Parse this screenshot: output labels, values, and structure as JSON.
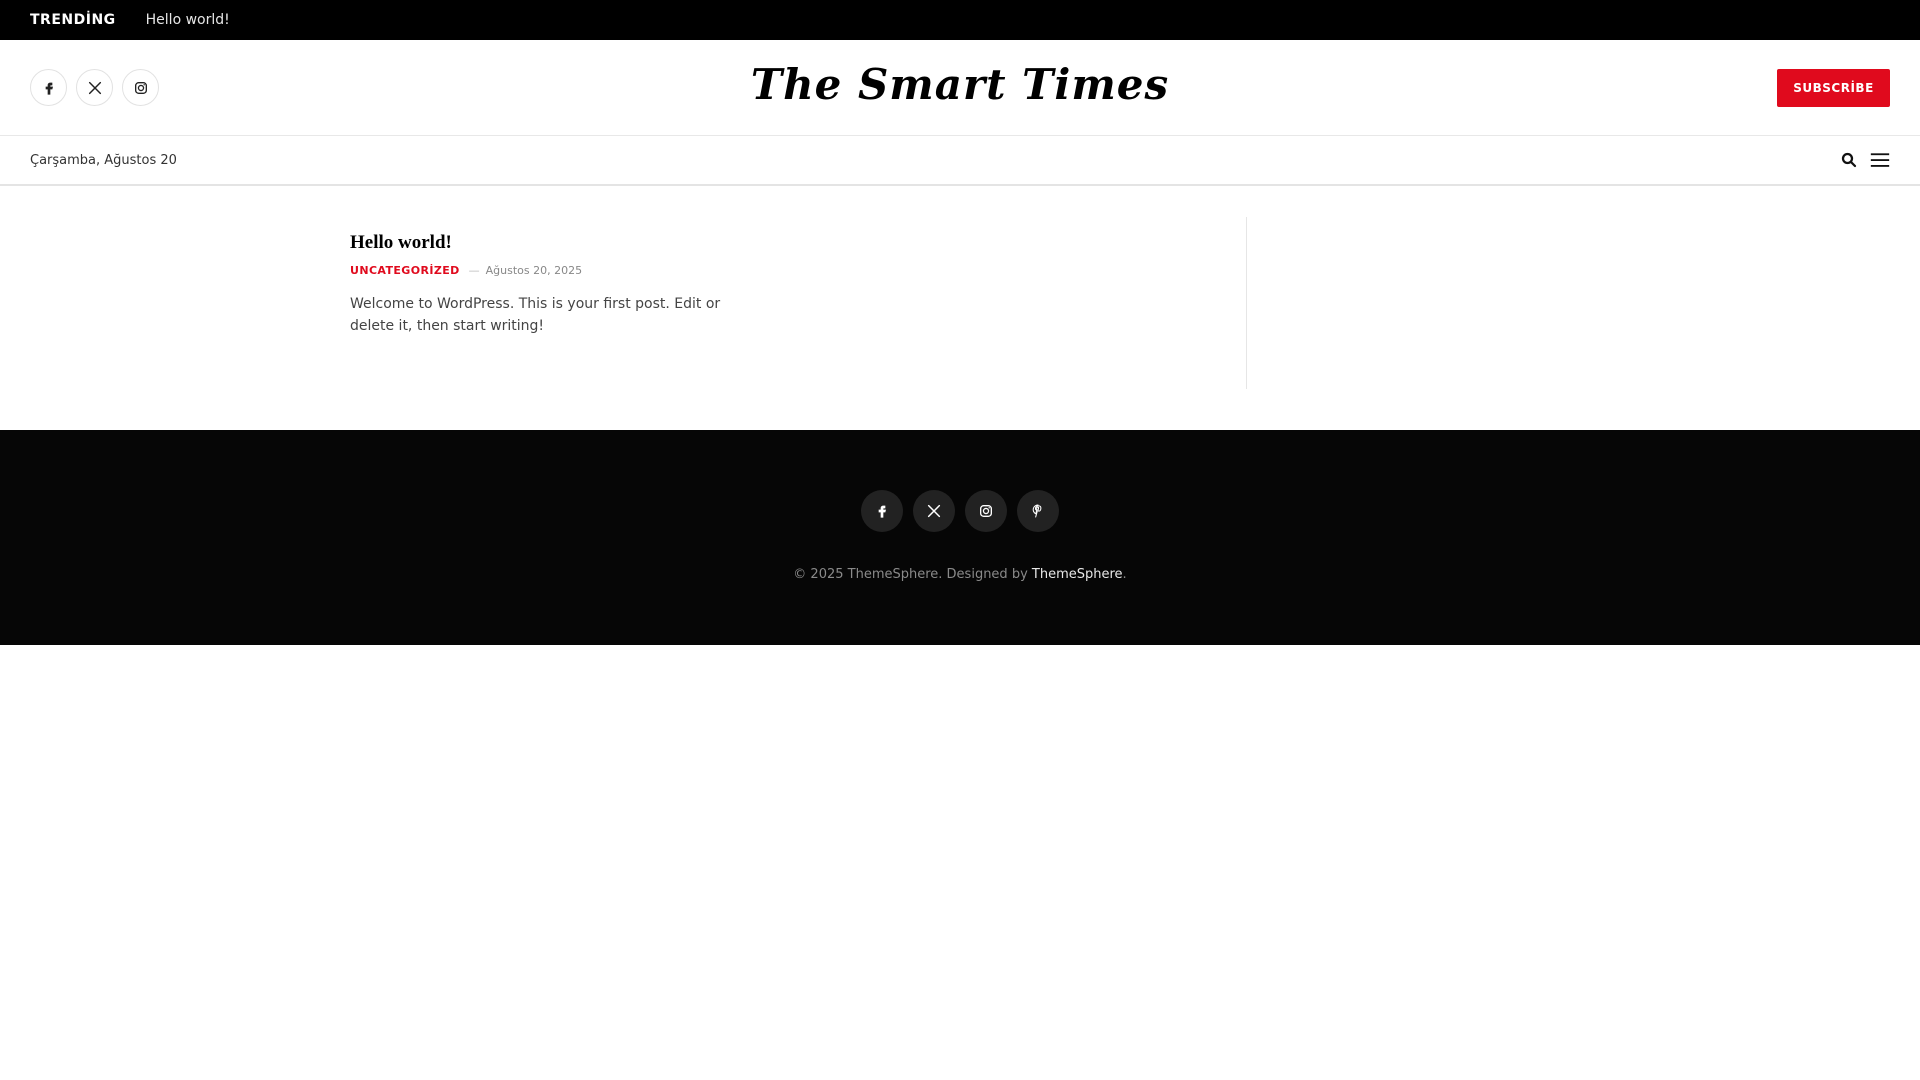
{
  "topbar": {
    "trending_label": "TRENDİNG",
    "trending_link": "Hello world!"
  },
  "header": {
    "site_title": "The Smart Times",
    "subscribe_label": "SUBSCRİBE",
    "social_icons": [
      "facebook-icon",
      "x-icon",
      "instagram-icon"
    ]
  },
  "subbar": {
    "date": "Çarşamba, Ağustos 20",
    "icons": [
      "search-icon",
      "menu-icon"
    ]
  },
  "post": {
    "title": "Hello world!",
    "category": "UNCATEGORİZED",
    "separator": "—",
    "date": "Ağustos 20, 2025",
    "excerpt": "Welcome to WordPress. This is your first post. Edit or delete it, then start writing!"
  },
  "footer": {
    "social_icons": [
      "facebook-icon",
      "x-icon",
      "instagram-icon",
      "pinterest-icon"
    ],
    "copyright_prefix": "© 2025 ThemeSphere. Designed by ",
    "copyright_link": "ThemeSphere",
    "copyright_suffix": "."
  },
  "colors": {
    "accent": "#e00a1d",
    "topbar_bg": "#000000",
    "footer_bg": "#060606"
  }
}
